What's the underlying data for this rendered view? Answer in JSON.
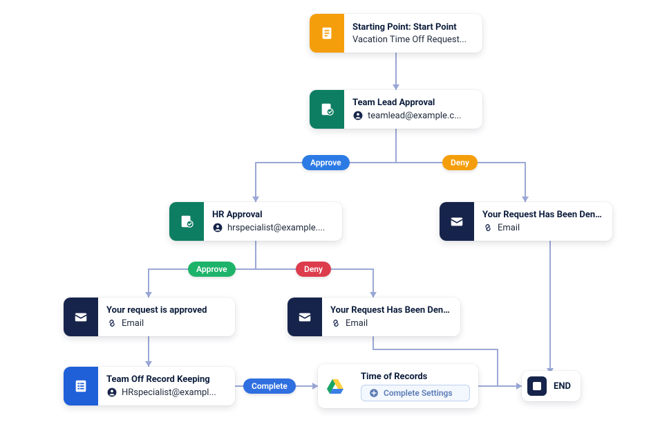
{
  "nodes": {
    "start": {
      "title": "Starting Point: Start Point",
      "subtitle": "Vacation Time Off Request..."
    },
    "tl": {
      "title": "Team Lead Approval",
      "subtitle": "teamlead@example.c..."
    },
    "hr": {
      "title": "HR Approval",
      "subtitle": "hrspecialist@example...."
    },
    "deny1": {
      "title": "Your Request Has Been Deni...",
      "subtitle": "Email"
    },
    "approved": {
      "title": "Your request is approved",
      "subtitle": "Email"
    },
    "deny2": {
      "title": "Your Request Has Been Deni...",
      "subtitle": "Email"
    },
    "record": {
      "title": "Team Off Record Keeping",
      "subtitle": "HRspecialist@exampl..."
    },
    "timerec": {
      "title": "Time of Records",
      "button": "Complete Settings"
    },
    "end": {
      "label": "END"
    }
  },
  "pills": {
    "tl_approve": "Approve",
    "tl_deny": "Deny",
    "hr_approve": "Approve",
    "hr_deny": "Deny",
    "complete": "Complete"
  },
  "colors": {
    "connector": "#9aa7d6"
  }
}
